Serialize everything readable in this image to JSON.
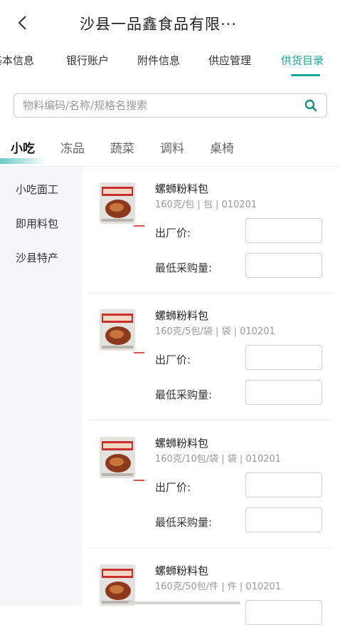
{
  "header": {
    "back_icon": "chevron-left-icon",
    "title": "沙县一品鑫食品有限···"
  },
  "tabs": [
    "基本信息",
    "银行账户",
    "附件信息",
    "供应管理",
    "供货目录"
  ],
  "active_tab": "供货目录",
  "search": {
    "placeholder": "物料编码/名称/规格名搜索",
    "value": "",
    "icon": "search-icon"
  },
  "categories": [
    "小吃",
    "冻品",
    "蔬菜",
    "调料",
    "桌椅"
  ],
  "active_category": "小吃",
  "sidebar": [
    "小吃面工",
    "即用料包",
    "沙县特产"
  ],
  "form_labels": {
    "price": "出厂价:",
    "min_qty": "最低采购量:"
  },
  "products": [
    {
      "name": "螺蛳粉料包",
      "spec": "160克/包 | 包 | 010201"
    },
    {
      "name": "螺蛳粉料包",
      "spec": "160克/5包/袋 | 袋 | 010201"
    },
    {
      "name": "螺蛳粉料包",
      "spec": "160克/10包/袋 | 袋 | 010201"
    },
    {
      "name": "螺蛳粉料包",
      "spec": "160克/50包/件 | 件 | 010201"
    }
  ],
  "colors": {
    "accent": "#1aa59a",
    "sidebar_bg": "#f5f6f7",
    "red_mark": "#d9534f"
  }
}
